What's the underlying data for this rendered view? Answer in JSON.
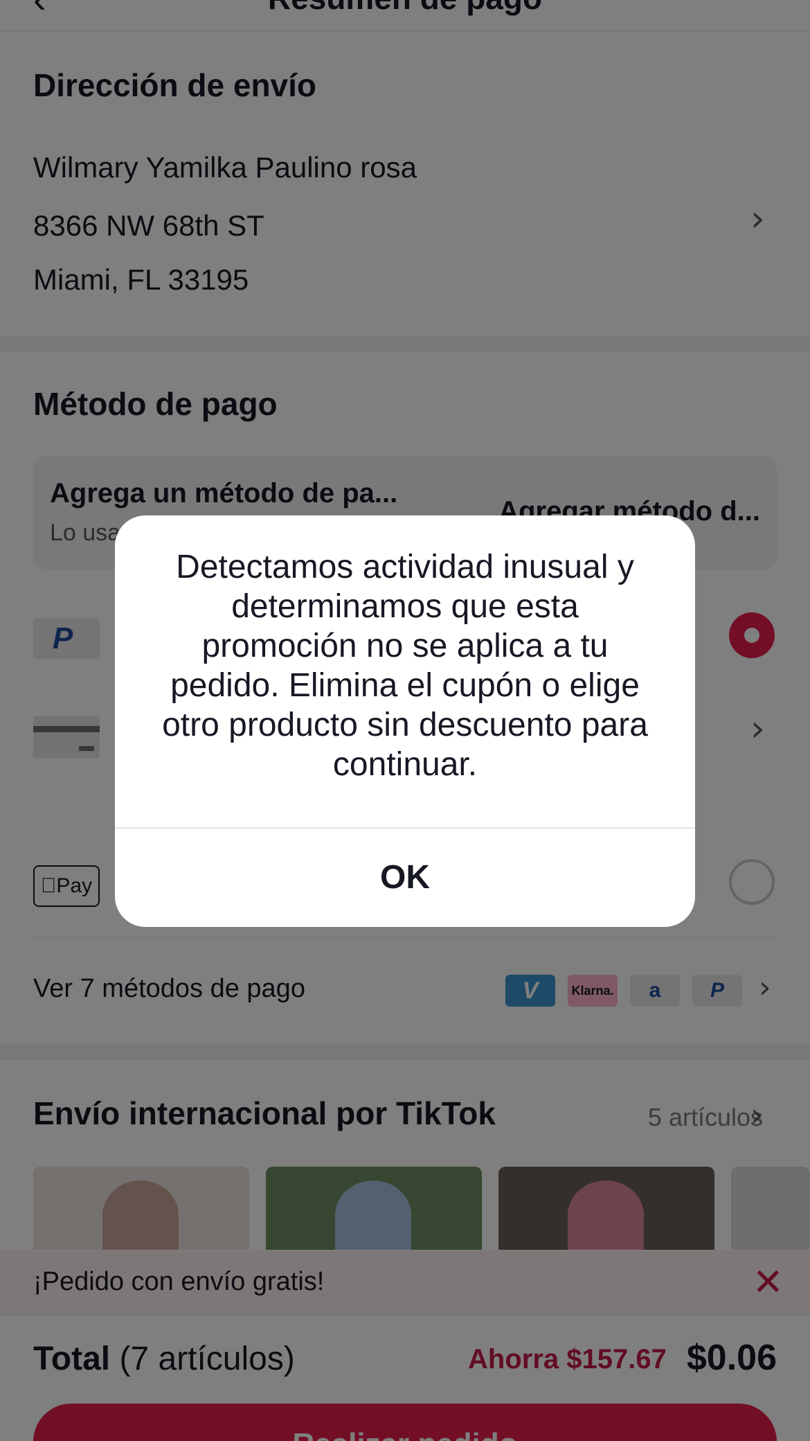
{
  "header": {
    "title": "Resumen de pago"
  },
  "shipping": {
    "title": "Dirección de envío",
    "name": "Wilmary Yamilka Paulino rosa",
    "street": "8366 NW 68th ST",
    "city": "Miami, FL 33195"
  },
  "payment": {
    "title": "Método de pago",
    "add_card": {
      "title": "Agrega un método de pa...",
      "subtitle": "Lo usa",
      "action": "Agregar método d..."
    },
    "methods": [
      {
        "icon": "paypal-icon",
        "selected": true
      },
      {
        "icon": "credit-card-icon",
        "selected": false
      },
      {
        "icon": "apple-pay-icon",
        "label": "Pay",
        "selected": false
      }
    ],
    "more_label": "Ver 7 métodos de pago",
    "more_badges": [
      "V",
      "Klarna.",
      "a",
      "P"
    ]
  },
  "shipping_section": {
    "title": "Envío internacional por TikTok",
    "count": "5 artículos"
  },
  "promo_banner": {
    "text": "¡Pedido con envío gratis!"
  },
  "footer": {
    "total_label": "Total",
    "items": "(7 artículos)",
    "savings": "Ahorra $157.67",
    "price": "$0.06",
    "button_label": "Realizar pedido"
  },
  "modal": {
    "message": "Detectamos actividad inusual y determinamos que esta promoción no se aplica a tu pedido. Elimina el cupón o elige otro producto sin descuento para continuar.",
    "ok_label": "OK"
  },
  "colors": {
    "accent": "#e41c4c",
    "savings": "#c41b48",
    "overlay": "rgba(0,0,0,0.5)"
  }
}
